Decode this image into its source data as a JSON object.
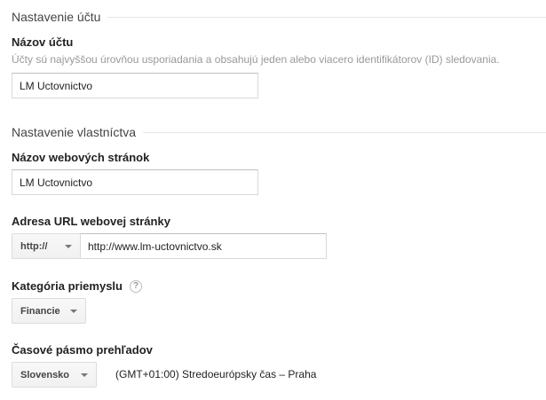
{
  "account_section": {
    "heading": "Nastavenie účtu",
    "name_label": "Názov účtu",
    "name_hint": "Účty sú najvyššou úrovňou usporiadania a obsahujú jeden alebo viacero identifikátorov (ID) sledovania.",
    "name_value": "LM Uctovnictvo"
  },
  "property_section": {
    "heading": "Nastavenie vlastníctva",
    "site_name_label": "Názov webových stránok",
    "site_name_value": "LM Uctovnictvo",
    "url_label": "Adresa URL webovej stránky",
    "protocol_selected": "http://",
    "url_value": "http://www.lm-uctovnictvo.sk",
    "industry_label": "Kategória priemyslu",
    "industry_help_glyph": "?",
    "industry_selected": "Financie",
    "timezone_label": "Časové pásmo prehľadov",
    "timezone_country_selected": "Slovensko",
    "timezone_text": "(GMT+01:00) Stredoeurópsky čas – Praha"
  },
  "icons": {
    "dropdown_caret": "chevron-down-icon",
    "help": "help-icon"
  },
  "colors": {
    "section_rule": "#e5e5e5",
    "hint_text": "#999999",
    "label_text": "#222222"
  }
}
